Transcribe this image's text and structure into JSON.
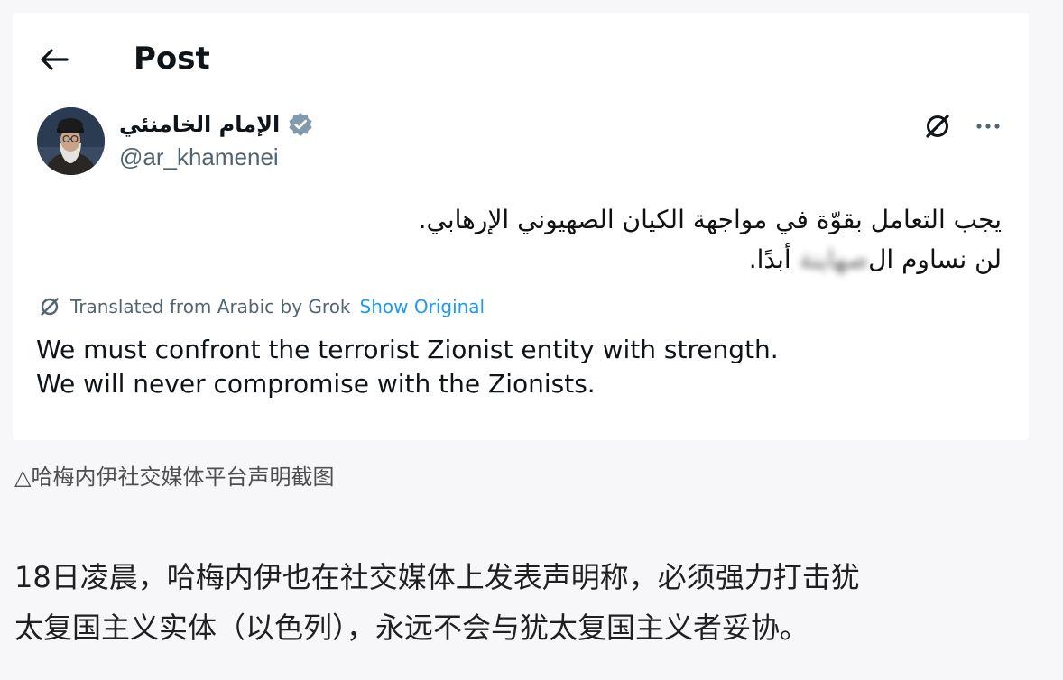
{
  "header": {
    "title": "Post",
    "back_icon": "back-arrow-icon"
  },
  "post": {
    "author": {
      "display_name": "الإمام الخامنئي",
      "handle": "@ar_khamenei",
      "verified": true,
      "avatar_icon": "avatar"
    },
    "icons": {
      "grok_icon": "grok-icon",
      "more_icon": "more-icon"
    },
    "arabic_text": {
      "line1": "يجب التعامل بقوّة في مواجهة الكيان الصهيوني الإرهابي.",
      "line2_prefix": "لن نساوم ال",
      "line2_blurred": "صهاينة",
      "line2_suffix": " أبدًا."
    },
    "translation": {
      "label": "Translated from Arabic by Grok",
      "show_original": "Show Original",
      "line1": "We must confront the terrorist Zionist entity with strength.",
      "line2": "We will never compromise with the Zionists."
    }
  },
  "caption": "△哈梅内伊社交媒体平台声明截图",
  "article": {
    "line1": "18日凌晨，哈梅内伊也在社交媒体上发表声明称，必须强力打击犹",
    "line2": "太复国主义实体（以色列），永远不会与犹太复国主义者妥协。"
  },
  "colors": {
    "accent": "#1d9bf0",
    "secondary_text": "#536471",
    "primary_text": "#0f1419",
    "verified": "#829aab"
  }
}
